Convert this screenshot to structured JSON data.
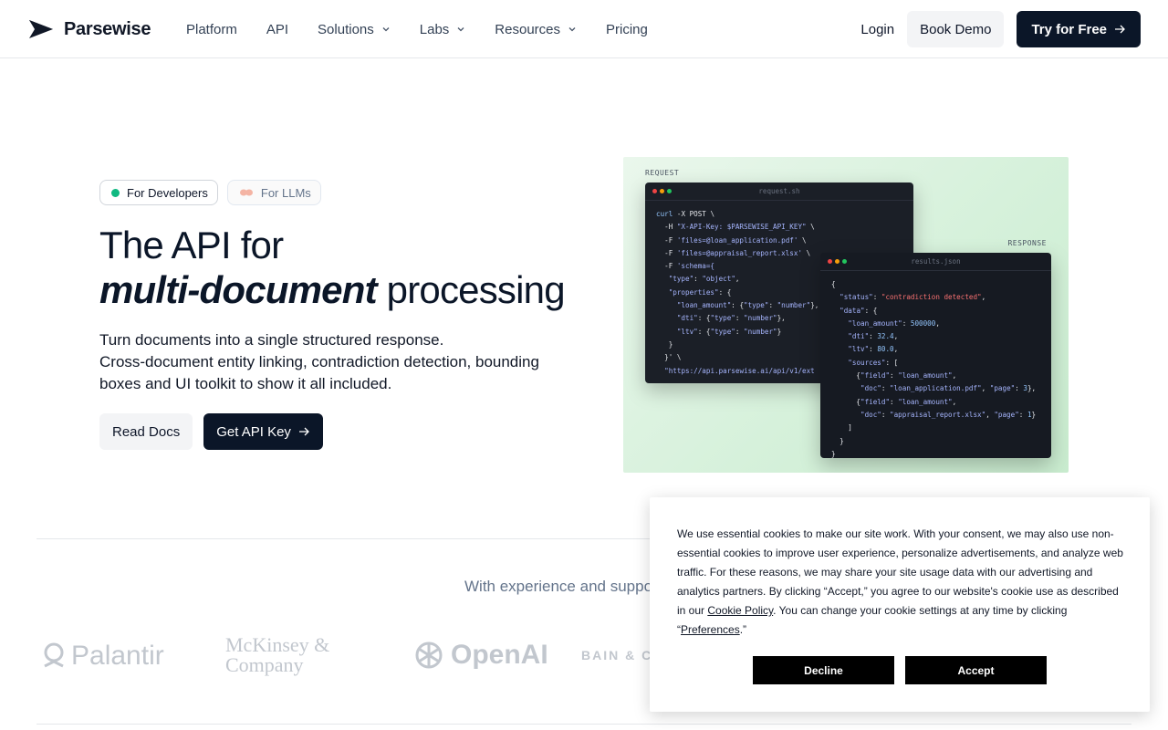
{
  "nav": {
    "brand": "Parsewise",
    "links": [
      {
        "label": "Platform",
        "dropdown": false
      },
      {
        "label": "API",
        "dropdown": false
      },
      {
        "label": "Solutions",
        "dropdown": true
      },
      {
        "label": "Labs",
        "dropdown": true
      },
      {
        "label": "Resources",
        "dropdown": true
      },
      {
        "label": "Pricing",
        "dropdown": false
      }
    ],
    "login": "Login",
    "book_demo": "Book Demo",
    "try_free": "Try for Free"
  },
  "hero": {
    "pills": [
      {
        "label": "For Developers",
        "active": true
      },
      {
        "label": "For LLMs",
        "active": false
      }
    ],
    "title_line1": "The API for",
    "title_emph": "multi-document",
    "title_rest": " processing",
    "desc_line1": "Turn documents into a single structured response.",
    "desc_line2": "Cross-document entity linking, contradiction detection, bounding boxes and UI toolkit to show it all included.",
    "btn_docs": "Read Docs",
    "btn_key": "Get API Key"
  },
  "code": {
    "request_tag": "REQUEST",
    "response_tag": "RESPONSE",
    "request_file": "request.sh",
    "response_file": "results.json"
  },
  "support": {
    "text": "With experience and suppo",
    "logos": [
      "Palantir",
      "McKinsey & Company",
      "OpenAI",
      "BAIN & CO"
    ]
  },
  "cookie": {
    "text_1": "We use essential cookies to make our site work. With your consent, we may also use non-essential cookies to improve user experience, personalize advertisements, and analyze web traffic. For these reasons, we may share your site usage data with our advertising and analytics partners. By clicking “Accept,” you agree to our website's cookie use as described in our ",
    "policy_link": "Cookie Policy",
    "text_2": ". You can change your cookie settings at any time by clicking “",
    "prefs_link": "Preferences",
    "text_3": ".”",
    "decline": "Decline",
    "accept": "Accept"
  },
  "colors": {
    "primary": "#0b1628",
    "accent_green": "#10b981",
    "code_bg": "#1b1f27",
    "muted": "#64748b"
  }
}
